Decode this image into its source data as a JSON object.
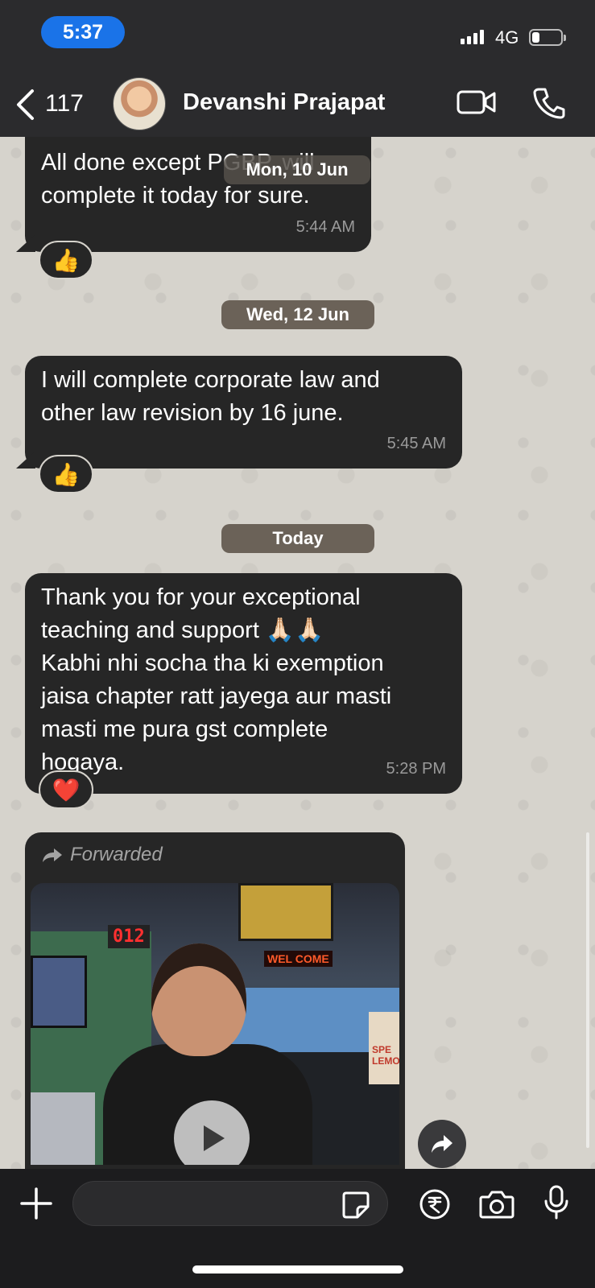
{
  "status_bar": {
    "time": "5:37",
    "network": "4G",
    "battery_level": 0.25
  },
  "header": {
    "back_count": "117",
    "contact_name": "Devanshi Prajapat"
  },
  "messages": [
    {
      "text": "All done except PGBP, will\ncomplete it today for sure.",
      "time": "5:44 AM",
      "reaction": "👍",
      "overlay_date": "Mon, 10 Jun"
    },
    {
      "date_chip": "Wed, 12 Jun",
      "text": "I will complete corporate law and\nother law revision by 16 june.",
      "time": "5:45 AM",
      "reaction": "👍"
    },
    {
      "date_chip": "Today",
      "text": "Thank you for your exceptional\nteaching and support 🙏🏻🙏🏻\nKabhi nhi socha tha ki exemption\njaisa chapter ratt jayega aur masti\nmasti me pura gst complete\nhogaya.",
      "time": "5:28 PM",
      "reaction": "❤️"
    }
  ],
  "media_message": {
    "forwarded_label": "Forwarded",
    "scene_counter": "012",
    "scene_sign": "WEL COME",
    "scene_side_sign": "SPE LEMO"
  },
  "composer": {
    "placeholder": ""
  }
}
